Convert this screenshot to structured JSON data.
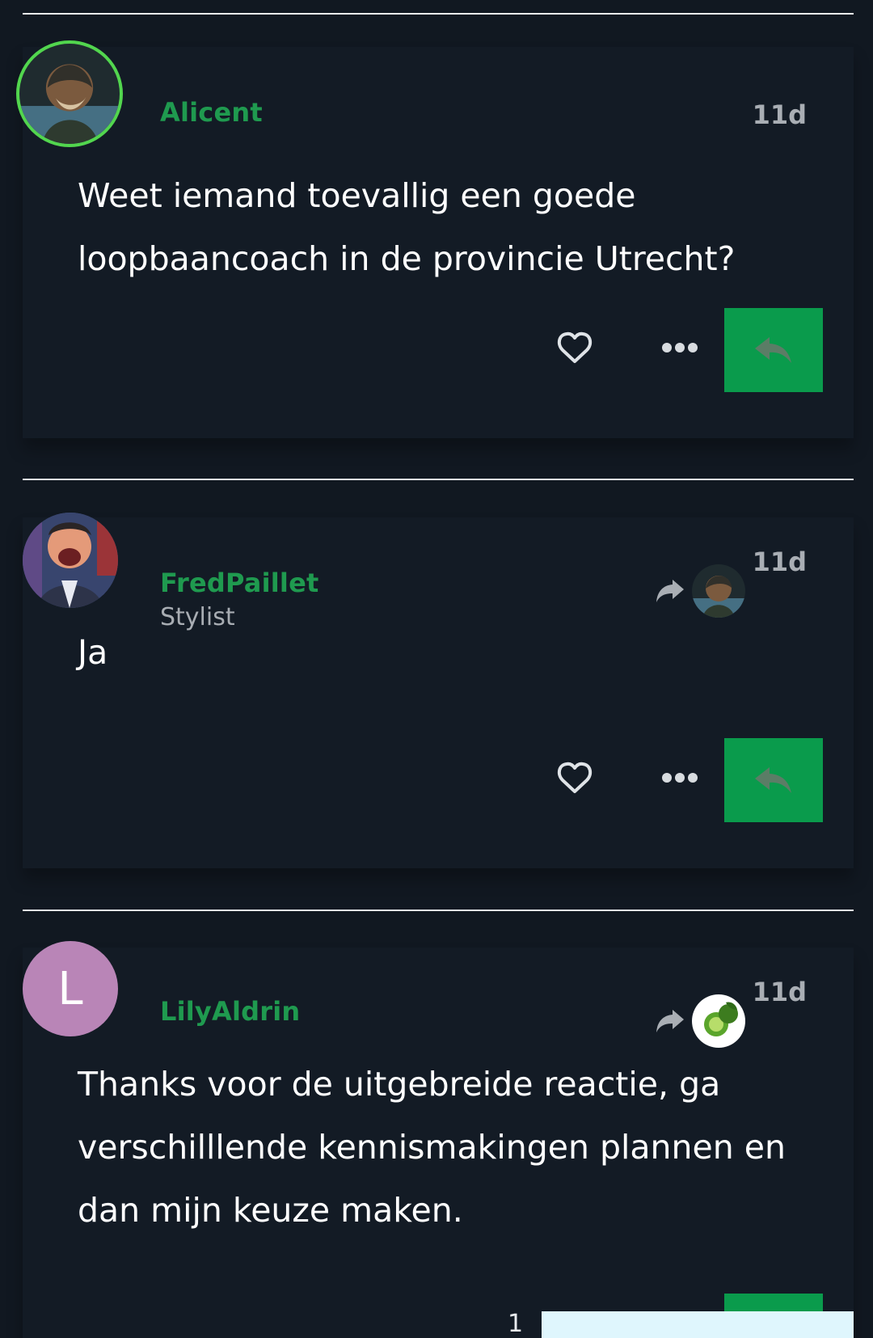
{
  "posts": [
    {
      "username": "Alicent",
      "user_title": "",
      "date": "11d",
      "body": "Weet iemand toevallig een goede loopbaancoach in de provincie Utrecht?",
      "avatar": "portrait-painting-avatar",
      "reply_to_avatar": ""
    },
    {
      "username": "FredPaillet",
      "user_title": "Stylist",
      "date": "11d",
      "body": "Ja",
      "avatar": "laughing-man-avatar",
      "reply_to_avatar": "portrait-painting-avatar"
    },
    {
      "username": "LilyAldrin",
      "user_title": "",
      "date": "11d",
      "body": "Thanks voor de uitgebreide reactie, ga verschilllende kennismakingen plannen en dan mijn keuze maken.",
      "avatar_letter": "L",
      "reply_to_avatar": "lime-fruit-avatar"
    }
  ],
  "actions": {
    "like_icon": "heart-outline-icon",
    "more_icon": "ellipsis-icon",
    "reply_icon": "reply-arrow-icon",
    "reply_to_icon": "share-arrow-icon"
  },
  "bottom": {
    "number": "1"
  },
  "colors": {
    "background": "#111821",
    "card": "#131b25",
    "username": "#1f9a4f",
    "reply_button": "#0a9b4c",
    "online_ring": "#52d64e",
    "letter_avatar": "#b985b7",
    "bottom_panel": "#dff6fd"
  }
}
